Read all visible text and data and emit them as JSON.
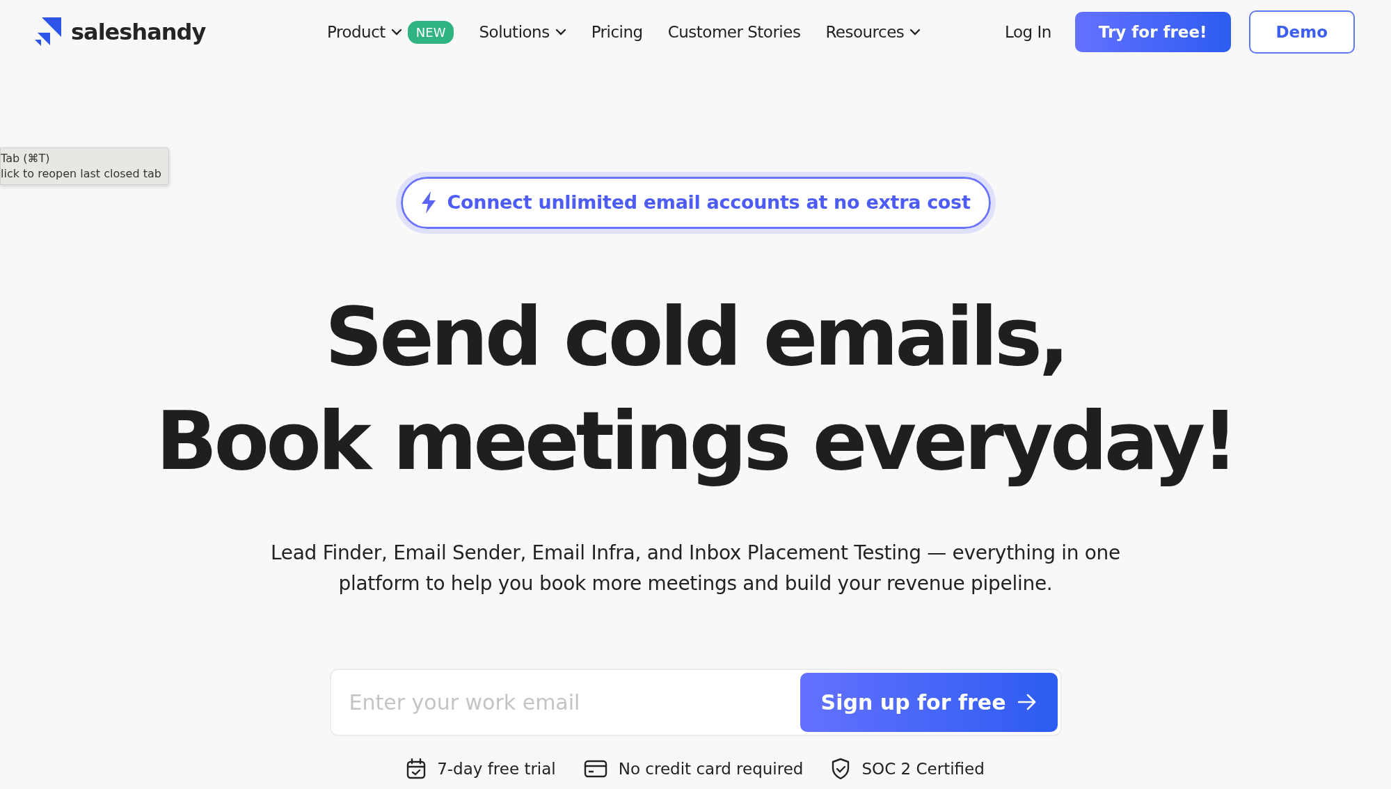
{
  "brand": {
    "name": "saleshandy"
  },
  "nav": [
    {
      "label": "Product",
      "dropdown": true,
      "badge": "NEW"
    },
    {
      "label": "Solutions",
      "dropdown": true
    },
    {
      "label": "Pricing",
      "dropdown": false
    },
    {
      "label": "Customer Stories",
      "dropdown": false
    },
    {
      "label": "Resources",
      "dropdown": true
    }
  ],
  "login": "Log In",
  "try_button": "Try for free!",
  "demo_button": "Demo",
  "tooltip": {
    "lines": [
      "Tab (⌘T)",
      "lick to reopen last closed tab"
    ]
  },
  "announcement": "Connect unlimited email accounts at no extra cost",
  "headline": [
    "Send cold emails,",
    "Book meetings everyday!"
  ],
  "subtitle": "Lead Finder, Email Sender, Email Infra, and Inbox Placement Testing — everything in one platform to help you book more meetings and build your revenue pipeline.",
  "signup": {
    "placeholder": "Enter your work email",
    "button": "Sign up for free"
  },
  "features": [
    {
      "kind": "calendar",
      "text": "7-day free trial"
    },
    {
      "kind": "card",
      "text": "No credit card required"
    },
    {
      "kind": "shield",
      "text": "SOC 2 Certified"
    }
  ]
}
